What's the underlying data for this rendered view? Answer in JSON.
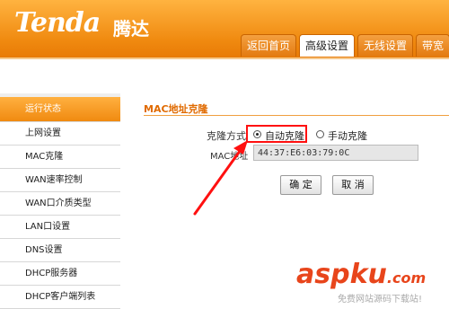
{
  "brand": {
    "logo": "Tenda",
    "logo_cn": "腾达"
  },
  "nav_tabs": [
    {
      "label": "返回首页"
    },
    {
      "label": "高级设置"
    },
    {
      "label": "无线设置"
    },
    {
      "label": "带宽"
    }
  ],
  "sidebar": {
    "items": [
      {
        "label": "运行状态"
      },
      {
        "label": "上网设置"
      },
      {
        "label": "MAC克隆"
      },
      {
        "label": "WAN速率控制"
      },
      {
        "label": "WAN口介质类型"
      },
      {
        "label": "LAN口设置"
      },
      {
        "label": "DNS设置"
      },
      {
        "label": "DHCP服务器"
      },
      {
        "label": "DHCP客户端列表"
      }
    ]
  },
  "main": {
    "section_title": "MAC地址克隆",
    "clone_mode_label": "克隆方式",
    "option_auto": "自动克隆",
    "option_manual": "手动克隆",
    "mac_label": "MAC地址",
    "mac_value": "44:37:E6:03:79:0C",
    "ok_label": "确 定",
    "cancel_label": "取 消"
  },
  "watermark": {
    "text": "aspku",
    "suffix": ".com",
    "sub": "免费网站源码下载站!"
  },
  "colors": {
    "accent": "#f08a10",
    "highlight": "#ff1010"
  }
}
